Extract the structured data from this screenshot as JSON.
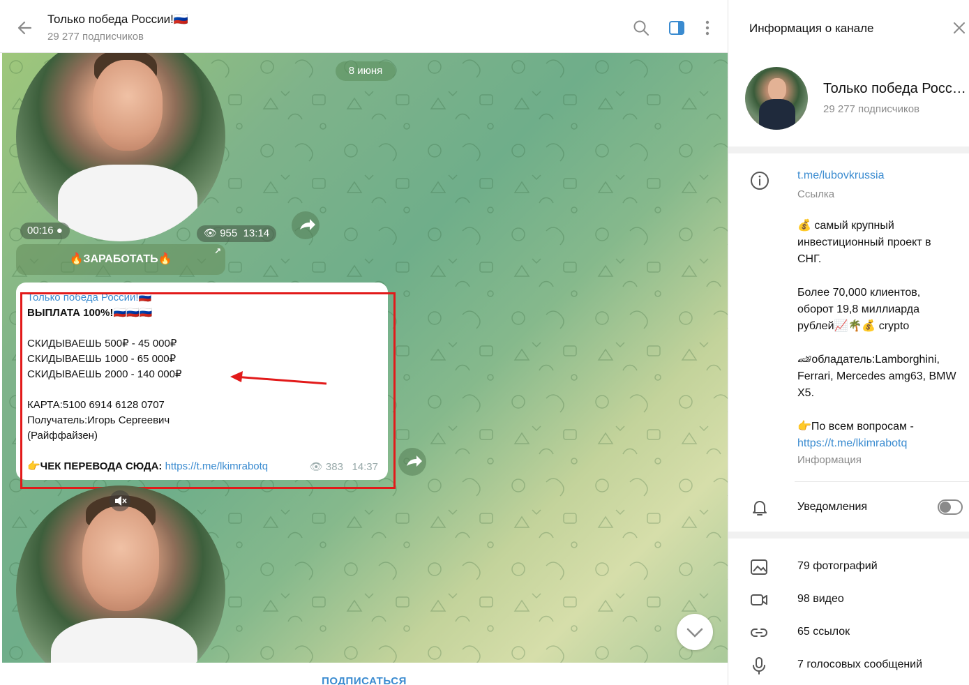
{
  "header": {
    "channel_title": "Только победа России!🇷🇺",
    "subscribers": "29 277 подписчиков"
  },
  "chat": {
    "date_pill": "8 июня",
    "video1": {
      "duration": "00:16",
      "views": "955",
      "time": "13:14"
    },
    "earn_button": "🔥ЗАРАБОТАТЬ🔥",
    "message": {
      "sender": "Только победа России!🇷🇺",
      "text": "ВЫПЛАТА 100%!🇷🇺🇷🇺🇷🇺\n\nСКИДЫВАЕШЬ 500₽ - 45 000₽\nСКИДЫВАЕШЬ 1000 - 65 000₽\nСКИДЫВАЕШЬ 2000 - 140 000₽\n\nКАРТА:5100 6914 6128 0707\nПолучатель:Игорь Сергеевич\n(Райффайзен)\n\n",
      "check_prefix": "👉ЧЕК ПЕРЕВОДА СЮДА: ",
      "check_link": "https://t.me/lkimrabotq",
      "views": "383",
      "time": "14:37"
    },
    "subscribe_label": "ПОДПИСАТЬСЯ"
  },
  "side": {
    "title": "Информация о канале",
    "channel_name": "Только победа России!",
    "subscribers": "29 277 подписчиков",
    "link": "t.me/lubovkrussia",
    "link_label": "Ссылка",
    "description": "💰 самый крупный инвестиционный проект в СНГ.\n\nБолее 70,000 клиентов, оборот 19,8 миллиарда рублей📈🌴💰 crypto\n\n🏎обладатель:Lamborghini, Ferrari, Mercedes amg63, BMW X5.\n\n👉По всем вопросам - ",
    "description_link": "https://t.me/lkimrabotq",
    "description_label": "Информация",
    "notifications_label": "Уведомления",
    "notifications_on": false,
    "media": [
      {
        "icon": "photo-icon",
        "label": "79 фотографий"
      },
      {
        "icon": "video-icon",
        "label": "98 видео"
      },
      {
        "icon": "link-icon",
        "label": "65 ссылок"
      },
      {
        "icon": "microphone-icon",
        "label": "7 голосовых сообщений"
      }
    ]
  },
  "colors": {
    "accent": "#3a8bd0",
    "highlight_box": "#e21a1a"
  }
}
